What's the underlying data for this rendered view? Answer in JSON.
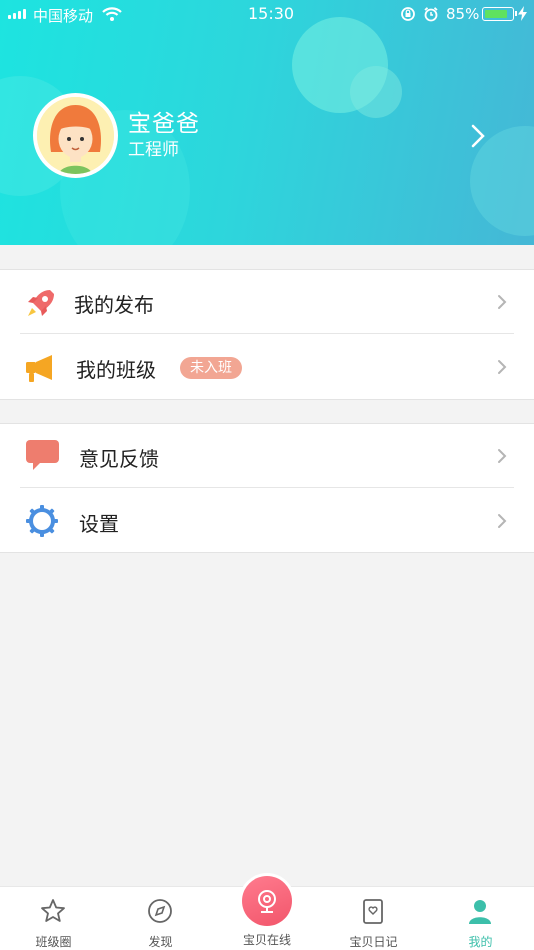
{
  "status_bar": {
    "carrier": "中国移动",
    "time": "15:30",
    "battery": "85%",
    "battery_level": 0.85
  },
  "profile": {
    "name": "宝爸爸",
    "title": "工程师"
  },
  "menu": {
    "group1": [
      {
        "label": "我的发布",
        "icon": "rocket-icon"
      },
      {
        "label": "我的班级",
        "icon": "megaphone-icon",
        "badge": "未入班"
      }
    ],
    "group2": [
      {
        "label": "意见反馈",
        "icon": "chat-bubble-icon"
      },
      {
        "label": "设置",
        "icon": "gear-icon"
      }
    ]
  },
  "tabs": [
    {
      "label": "班级圈",
      "icon": "star-icon"
    },
    {
      "label": "发现",
      "icon": "compass-icon"
    },
    {
      "label": "宝贝在线",
      "icon": "webcam-icon"
    },
    {
      "label": "宝贝日记",
      "icon": "diary-icon"
    },
    {
      "label": "我的",
      "icon": "person-icon",
      "active": true
    }
  ],
  "colors": {
    "header_start": "#1de4e0",
    "header_end": "#45b7d6",
    "badge": "#f2a693",
    "active_tab": "#3cbfaa",
    "center_button": "#f2566b"
  }
}
